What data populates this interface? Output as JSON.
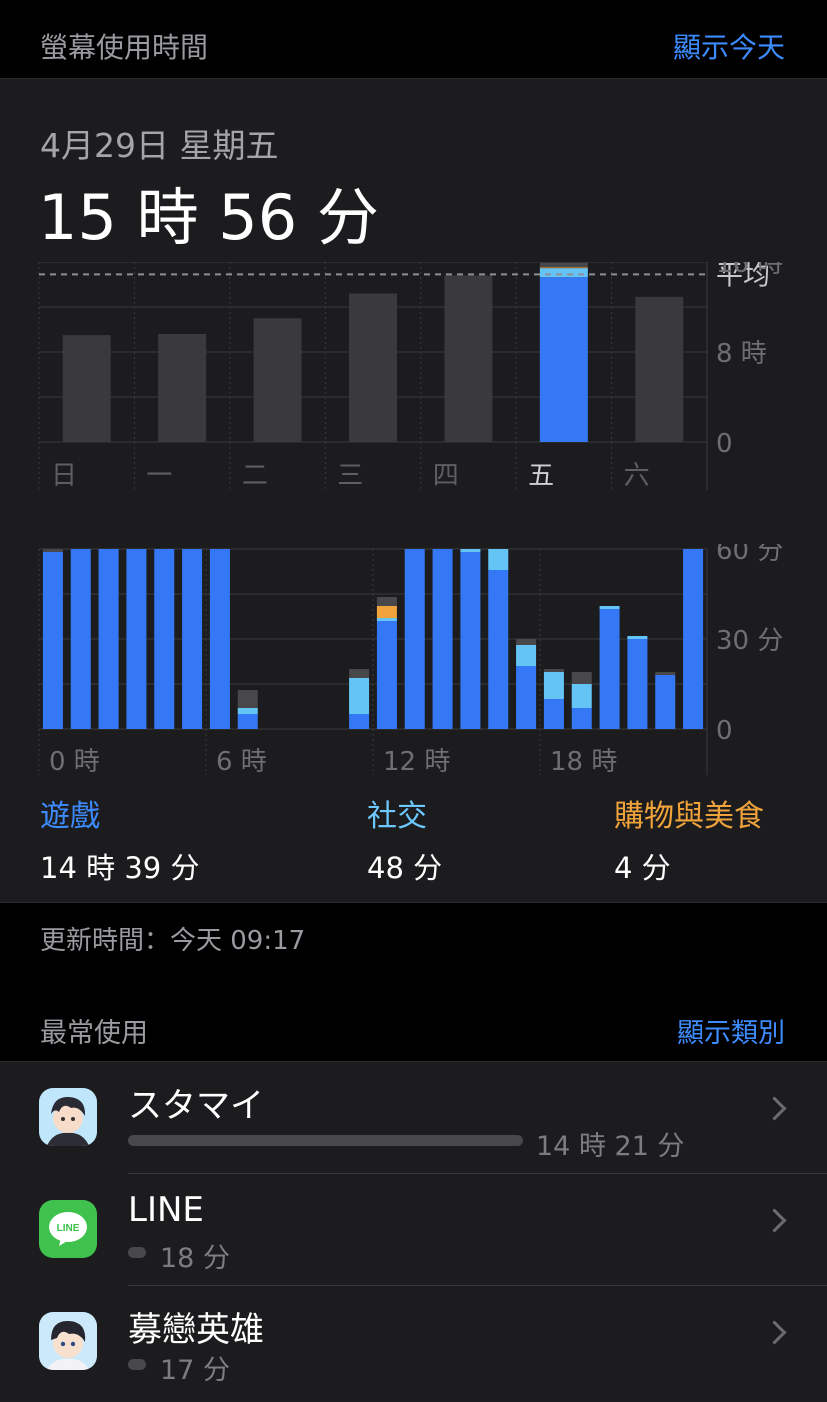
{
  "header": {
    "title": "螢幕使用時間",
    "show_today": "顯示今天"
  },
  "summary": {
    "date": "4月29日 星期五",
    "total": "15 時 56 分"
  },
  "colors": {
    "games": "#3478f6",
    "social": "#64c4f6",
    "shopping": "#f0a33a",
    "other": "#48484a",
    "accent": "#3d8cff"
  },
  "chart_data": [
    {
      "type": "bar",
      "categories": [
        "日",
        "一",
        "二",
        "三",
        "四",
        "五",
        "六"
      ],
      "values": [
        9.5,
        9.6,
        11.0,
        13.2,
        14.8,
        15.93,
        12.9
      ],
      "highlight_index": 5,
      "highlight_split": {
        "games": 14.65,
        "social": 0.8,
        "shopping": 0.07,
        "other": 0.41
      },
      "average": 14.9,
      "average_label": "平均",
      "y_ticks": [
        "16 時",
        "8 時",
        "0"
      ],
      "ylim": [
        0,
        16
      ]
    },
    {
      "type": "bar",
      "stacked": true,
      "x_ticks": [
        "0 時",
        "6 時",
        "12 時",
        "18 時"
      ],
      "y_ticks": [
        "60 分",
        "30 分",
        "0"
      ],
      "ylim": [
        0,
        60
      ],
      "hours": [
        {
          "games": 59,
          "social": 0,
          "shopping": 0,
          "other": 1
        },
        {
          "games": 60,
          "social": 0,
          "shopping": 0,
          "other": 0
        },
        {
          "games": 60,
          "social": 0,
          "shopping": 0,
          "other": 0
        },
        {
          "games": 60,
          "social": 0,
          "shopping": 0,
          "other": 0
        },
        {
          "games": 60,
          "social": 0,
          "shopping": 0,
          "other": 0
        },
        {
          "games": 60,
          "social": 0,
          "shopping": 0,
          "other": 0
        },
        {
          "games": 60,
          "social": 0,
          "shopping": 0,
          "other": 0
        },
        {
          "games": 5,
          "social": 2,
          "shopping": 0,
          "other": 6
        },
        {
          "games": 0,
          "social": 0,
          "shopping": 0,
          "other": 0
        },
        {
          "games": 0,
          "social": 0,
          "shopping": 0,
          "other": 0
        },
        {
          "games": 0,
          "social": 0,
          "shopping": 0,
          "other": 0
        },
        {
          "games": 5,
          "social": 12,
          "shopping": 0,
          "other": 3
        },
        {
          "games": 36,
          "social": 1,
          "shopping": 4,
          "other": 3
        },
        {
          "games": 60,
          "social": 0,
          "shopping": 0,
          "other": 0
        },
        {
          "games": 60,
          "social": 0,
          "shopping": 0,
          "other": 0
        },
        {
          "games": 59,
          "social": 1,
          "shopping": 0,
          "other": 0
        },
        {
          "games": 53,
          "social": 7,
          "shopping": 0,
          "other": 0
        },
        {
          "games": 21,
          "social": 7,
          "shopping": 0,
          "other": 2
        },
        {
          "games": 10,
          "social": 9,
          "shopping": 0,
          "other": 1
        },
        {
          "games": 7,
          "social": 8,
          "shopping": 0,
          "other": 4
        },
        {
          "games": 40,
          "social": 1,
          "shopping": 0,
          "other": 0
        },
        {
          "games": 30,
          "social": 1,
          "shopping": 0,
          "other": 0
        },
        {
          "games": 18,
          "social": 0,
          "shopping": 0,
          "other": 1
        },
        {
          "games": 60,
          "social": 0,
          "shopping": 0,
          "other": 0
        }
      ]
    }
  ],
  "categories": [
    {
      "name": "遊戲",
      "value": "14 時 39 分"
    },
    {
      "name": "社交",
      "value": "48 分"
    },
    {
      "name": "購物與美食",
      "value": "4 分"
    }
  ],
  "updated": "更新時間：今天 09:17",
  "most_used": {
    "title": "最常使用",
    "show_categories": "顯示類別",
    "apps": [
      {
        "name": "スタマイ",
        "time": "14 時 21 分",
        "icon": "stamy-app-icon",
        "fraction": 1.0
      },
      {
        "name": "LINE",
        "time": "18 分",
        "icon": "line-app-icon",
        "fraction": 0.021
      },
      {
        "name": "募戀英雄",
        "time": "17 分",
        "icon": "boyfriend-game-icon",
        "fraction": 0.02
      }
    ]
  }
}
